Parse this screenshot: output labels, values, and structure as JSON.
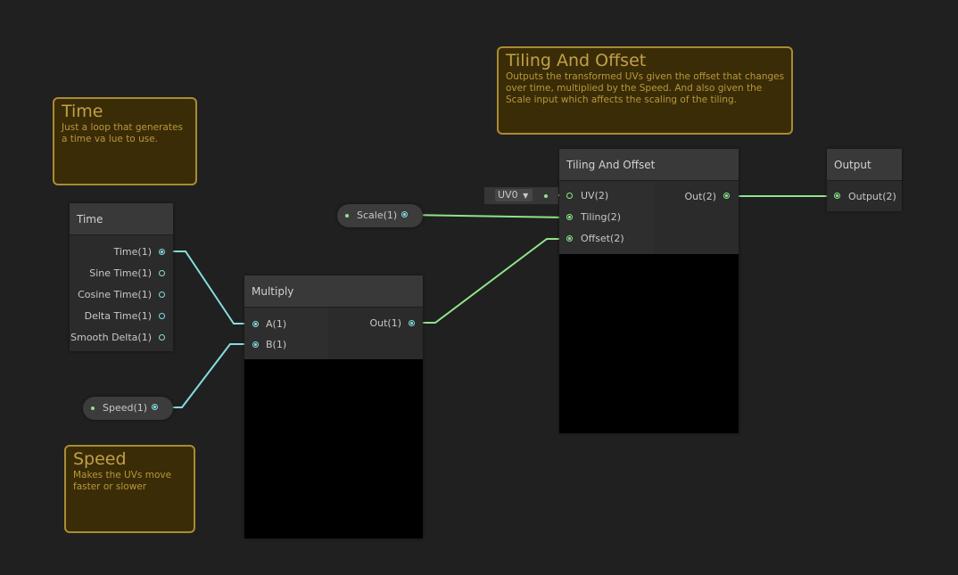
{
  "sticky_notes": [
    {
      "title": "Time",
      "body": "Just a loop that generates a time va lue to use."
    },
    {
      "title": "Speed",
      "body": "Makes the UVs move faster or slower"
    },
    {
      "title": "Tiling And Offset",
      "body": "Outputs the transformed UVs given the offset that changes over time, multiplied by the Speed. And also given the Scale input which affects the scaling of the tiling."
    }
  ],
  "time_node": {
    "title": "Time",
    "outputs": [
      "Time(1)",
      "Sine Time(1)",
      "Cosine Time(1)",
      "Delta Time(1)",
      "Smooth Delta(1)"
    ]
  },
  "multiply_node": {
    "title": "Multiply",
    "inputs": [
      "A(1)",
      "B(1)"
    ],
    "outputs": [
      "Out(1)"
    ]
  },
  "tiling_node": {
    "title": "Tiling And Offset",
    "inputs": [
      "UV(2)",
      "Tiling(2)",
      "Offset(2)"
    ],
    "outputs": [
      "Out(2)"
    ],
    "uv_dropdown": "UV0"
  },
  "output_node": {
    "title": "Output",
    "inputs": [
      "Output(2)"
    ]
  },
  "properties": {
    "scale": "Scale(1)",
    "speed": "Speed(1)"
  },
  "colors": {
    "float_wire": "#84dde0",
    "vector2_wire": "#8ee48a",
    "sticky_border": "#a98c32",
    "sticky_bg": "#3a2c06"
  }
}
